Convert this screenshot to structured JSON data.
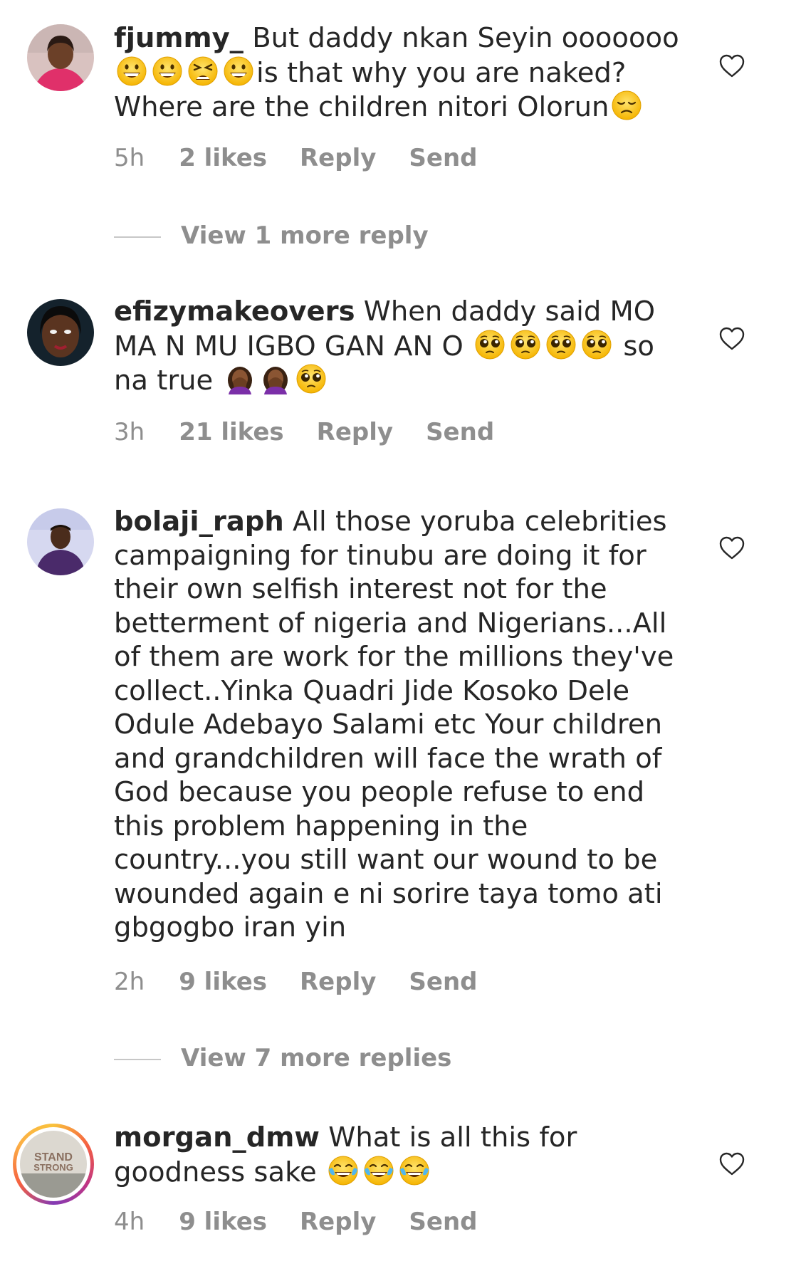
{
  "comments": [
    {
      "username": "fjummy_",
      "text_parts": [
        "But daddy nkan Seyin ooooooo",
        "is that why you are naked? Where are the children nitori Olorun"
      ],
      "time": "5h",
      "likes": "2 likes",
      "reply": "Reply",
      "send": "Send",
      "view_more": "View 1 more reply"
    },
    {
      "username": "efizymakeovers",
      "text_parts": [
        "When daddy said MO MA N MU IGBO GAN AN O",
        "so na true"
      ],
      "time": "3h",
      "likes": "21 likes",
      "reply": "Reply",
      "send": "Send"
    },
    {
      "username": "bolaji_raph",
      "text_parts": [
        "All those yoruba celebrities campaigning for tinubu are doing it for their own selfish interest not for the betterment of nigeria and Nigerians...All of them are work for the millions they've collect..Yinka Quadri Jide Kosoko Dele Odule Adebayo Salami etc Your children and grandchildren will face the wrath of God because you people refuse to end this problem happening in the country...you still want our wound to be wounded again e ni sorire taya tomo ati gbgogbo iran yin"
      ],
      "time": "2h",
      "likes": "9 likes",
      "reply": "Reply",
      "send": "Send",
      "view_more": "View 7 more replies"
    },
    {
      "username": "morgan_dmw",
      "text_parts": [
        "What is all this for goodness sake"
      ],
      "time": "4h",
      "likes": "9 likes",
      "reply": "Reply",
      "send": "Send",
      "avatar_text": [
        "STAND",
        "STRONG"
      ]
    }
  ],
  "colors": {
    "text": "#262626",
    "meta": "#8e8e8e",
    "divider": "#c7c7c7"
  },
  "icons": {
    "like": "heart-outline-icon",
    "grin": "grinning-face-emoji",
    "tired": "tired-face-emoji",
    "disappointed": "disappointed-face-emoji",
    "pleading": "pleading-face-emoji",
    "facepalm": "woman-facepalming-emoji",
    "tears_of_joy": "face-with-tears-of-joy-emoji"
  }
}
